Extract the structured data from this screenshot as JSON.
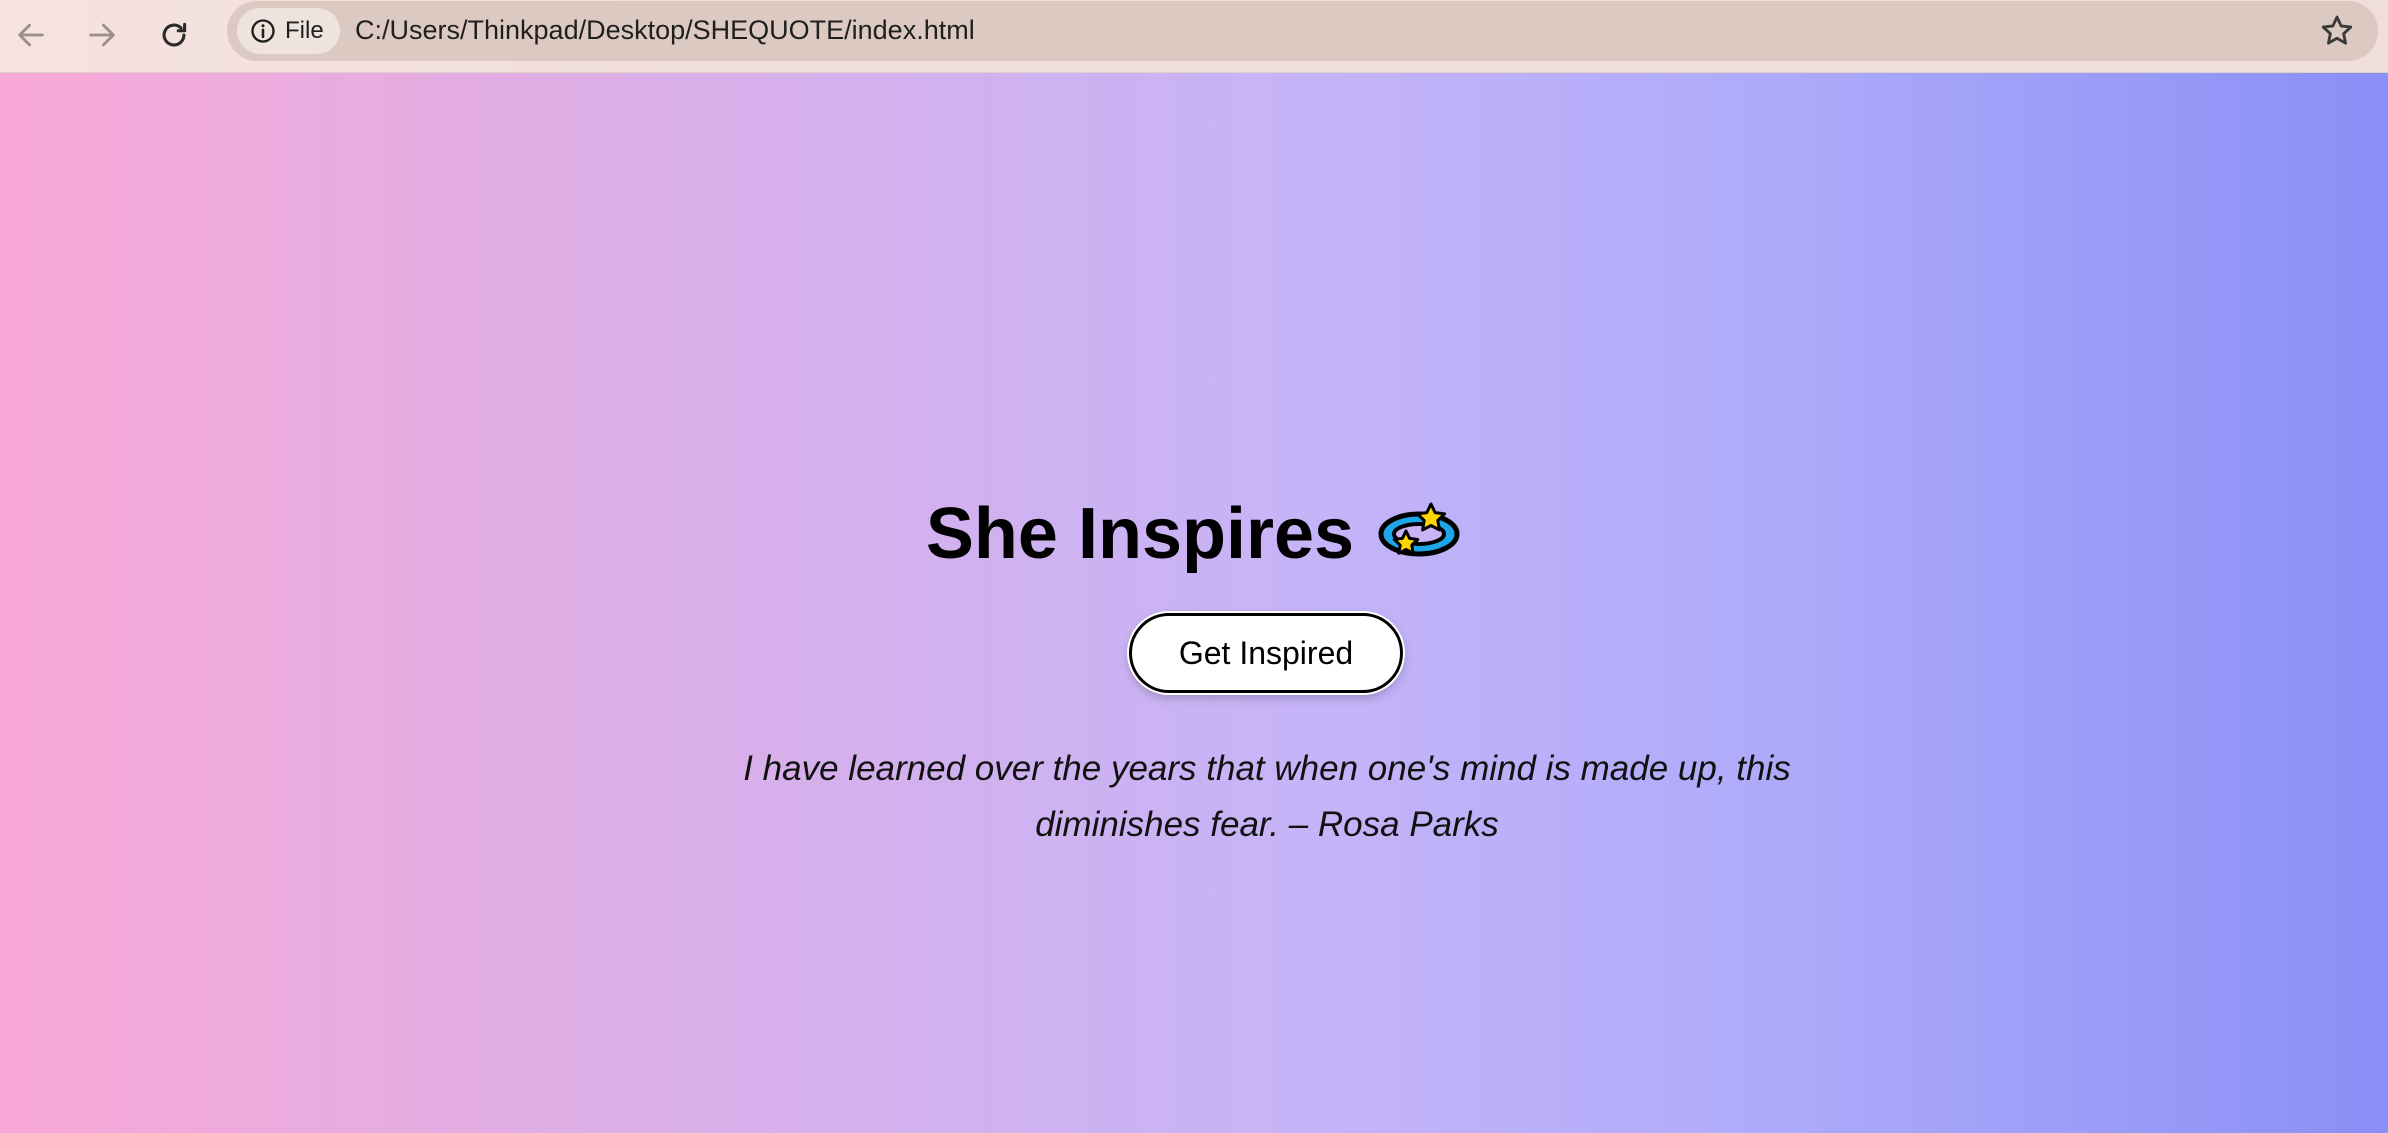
{
  "browser": {
    "site_info_label": "File",
    "url": "C:/Users/Thinkpad/Desktop/SHEQUOTE/index.html",
    "icons": {
      "back": "arrow-left-icon",
      "forward": "arrow-right-icon",
      "reload": "reload-icon",
      "info": "info-icon",
      "bookmark": "star-icon"
    }
  },
  "main": {
    "title": "She Inspires",
    "title_icon": "dizzy-star-icon",
    "button_label": "Get Inspired",
    "quote_text": "I have learned over the years that when one's mind is made up, this diminishes fear. – Rosa Parks"
  },
  "colors": {
    "gradient_start": "#f8a8d6",
    "gradient_mid": "#c6b4f8",
    "gradient_end": "#8a8ff6",
    "button_bg": "#ffffff",
    "text": "#000000"
  }
}
